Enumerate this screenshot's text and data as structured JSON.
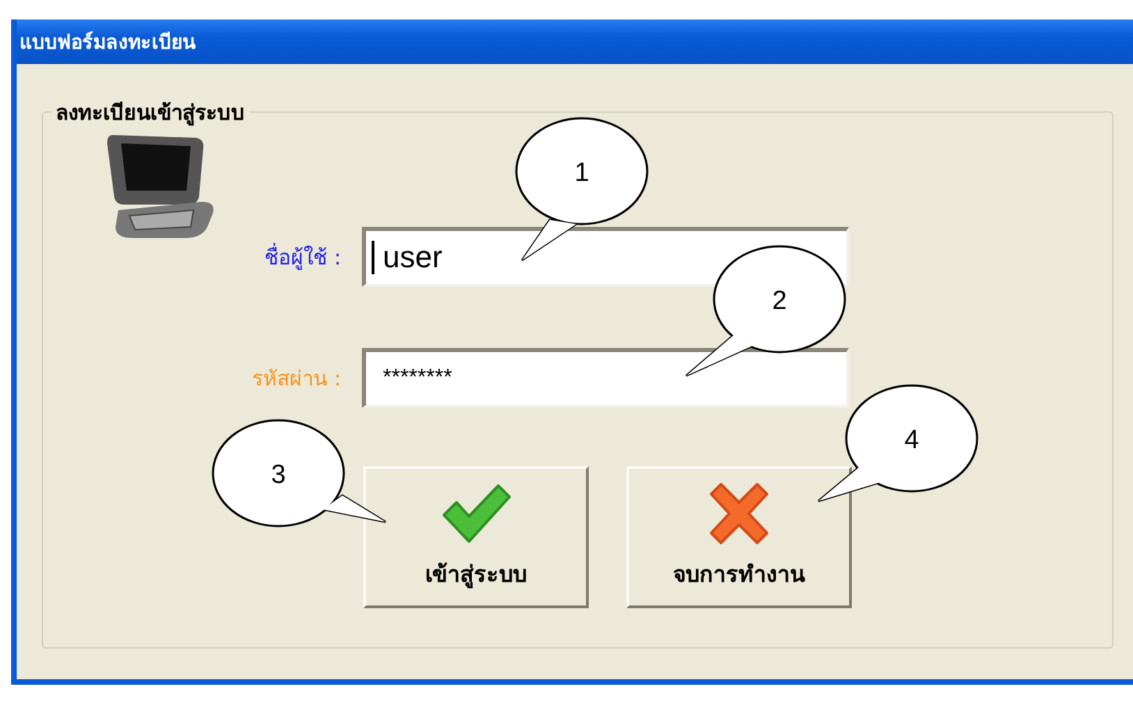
{
  "window": {
    "title": "แบบฟอร์มลงทะเบียน"
  },
  "group": {
    "title": "ลงทะเบียนเข้าสู่ระบบ"
  },
  "fields": [
    {
      "label": "ชื่อผู้ใช้ :",
      "color": "#1f1fe6",
      "value": "user",
      "focused": true
    },
    {
      "label": "รหัสผ่าน :",
      "color": "#f7941d",
      "value": "********",
      "focused": false
    }
  ],
  "buttons": [
    {
      "label": "เข้าสู่ระบบ",
      "kind": "ok"
    },
    {
      "label": "จบการทำงาน",
      "kind": "cancel"
    }
  ],
  "callouts": [
    {
      "number": "1"
    },
    {
      "number": "2"
    },
    {
      "number": "3"
    },
    {
      "number": "4"
    }
  ]
}
